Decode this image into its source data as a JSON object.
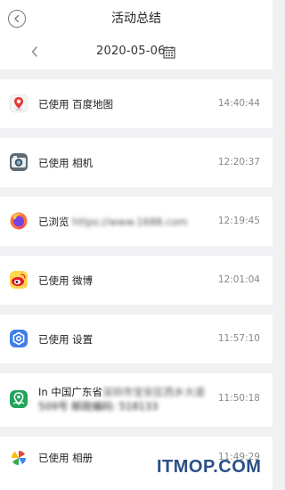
{
  "header": {
    "title": "活动总结",
    "date": "2020-05-06"
  },
  "items": [
    {
      "icon": "baidu-map-icon",
      "prefix": "已使用 ",
      "label": "百度地图",
      "time": "14:40:44"
    },
    {
      "icon": "camera-icon",
      "prefix": "已使用 ",
      "label": "相机",
      "time": "12:20:37"
    },
    {
      "icon": "firefox-icon",
      "prefix": "已浏览 ",
      "label": "https://www.1688.com",
      "time": "12:19:45"
    },
    {
      "icon": "weibo-icon",
      "prefix": "已使用 ",
      "label": "微博",
      "time": "12:01:04"
    },
    {
      "icon": "settings-icon",
      "prefix": "已使用 ",
      "label": "设置",
      "time": "11:57:10"
    },
    {
      "icon": "location-icon",
      "prefix": "In 中国广东省",
      "label": "深圳市宝安区西乡大道",
      "line2": "509号 邮政编码: 518133",
      "time": "11:50:18"
    },
    {
      "icon": "photos-icon",
      "prefix": "已使用 ",
      "label": "相册",
      "time": "11:49:29"
    }
  ],
  "watermark": "ITMOP.COM"
}
